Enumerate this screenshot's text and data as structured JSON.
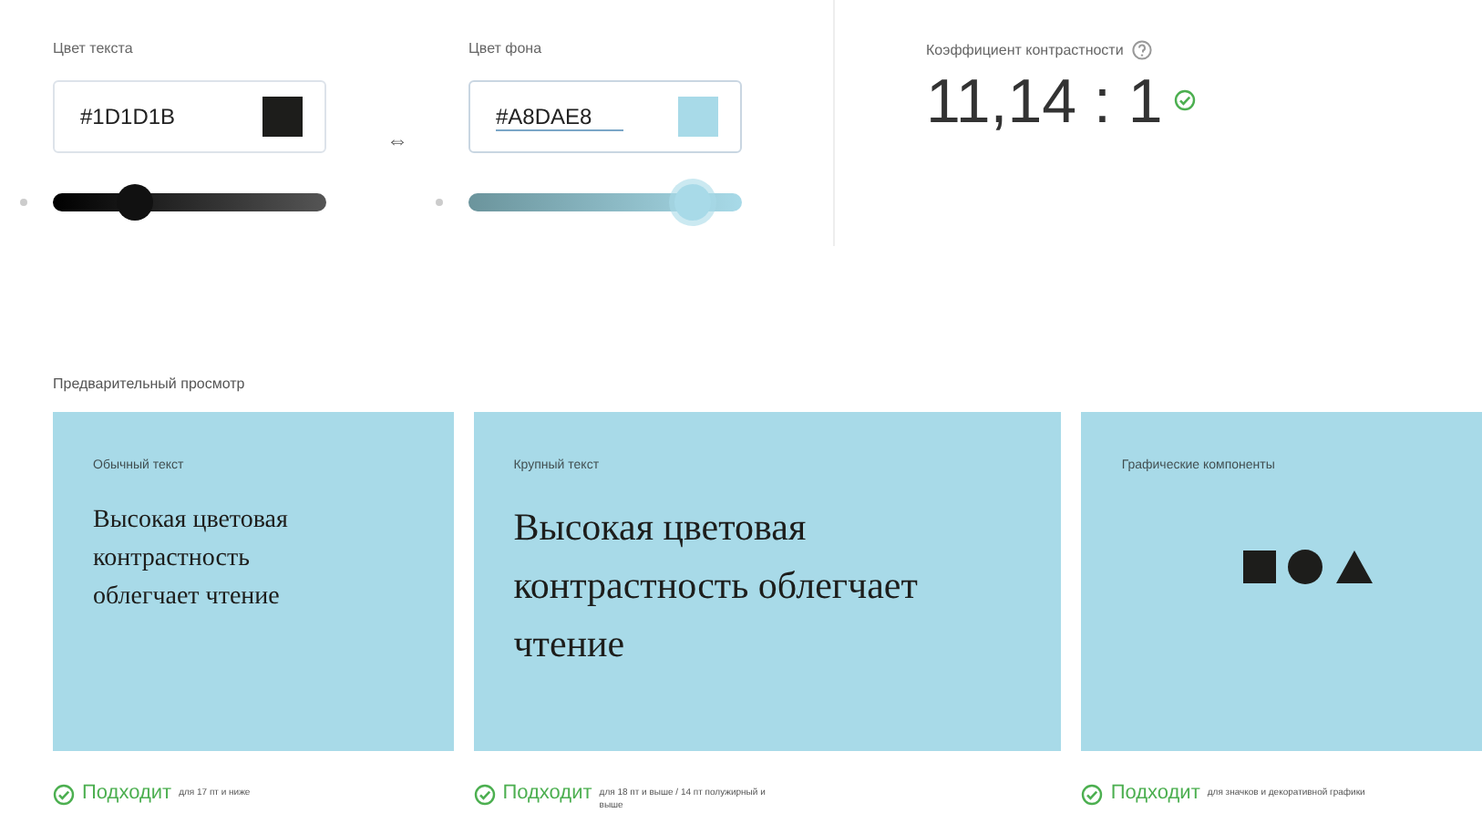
{
  "color_fields": [
    {
      "label": "Цвет текста",
      "value": "#1D1D1B",
      "color": "#1d1d1b",
      "focused": false,
      "level": 0.3
    },
    {
      "label": "Цвет фона",
      "value": "#A8DAE8",
      "color": "#a8dae8",
      "focused": true,
      "level": 0.82
    }
  ],
  "swap_icon": "⇔",
  "contrast": {
    "label": "Коэффициент контрастности",
    "ratio": "11,14 : 1",
    "passed": true
  },
  "preview": {
    "title": "Предварительный просмотр",
    "cards": [
      {
        "kind": "text-small",
        "label": "Обычный текст",
        "sample": "Высокая цветовая контрастность облегчает чтение",
        "verdict": "Подходит",
        "note": "для 17 пт и ниже",
        "passed": true
      },
      {
        "kind": "text-large",
        "label": "Крупный текст",
        "sample": "Высокая цветовая контрастность облегчает чтение",
        "verdict": "Подходит",
        "note": "для 18 пт и выше / 14 пт полужирный и выше",
        "passed": true
      },
      {
        "kind": "graphics",
        "label": "Графические компоненты",
        "verdict": "Подходит",
        "note": "для значков и декоративной графики",
        "passed": true
      }
    ]
  }
}
